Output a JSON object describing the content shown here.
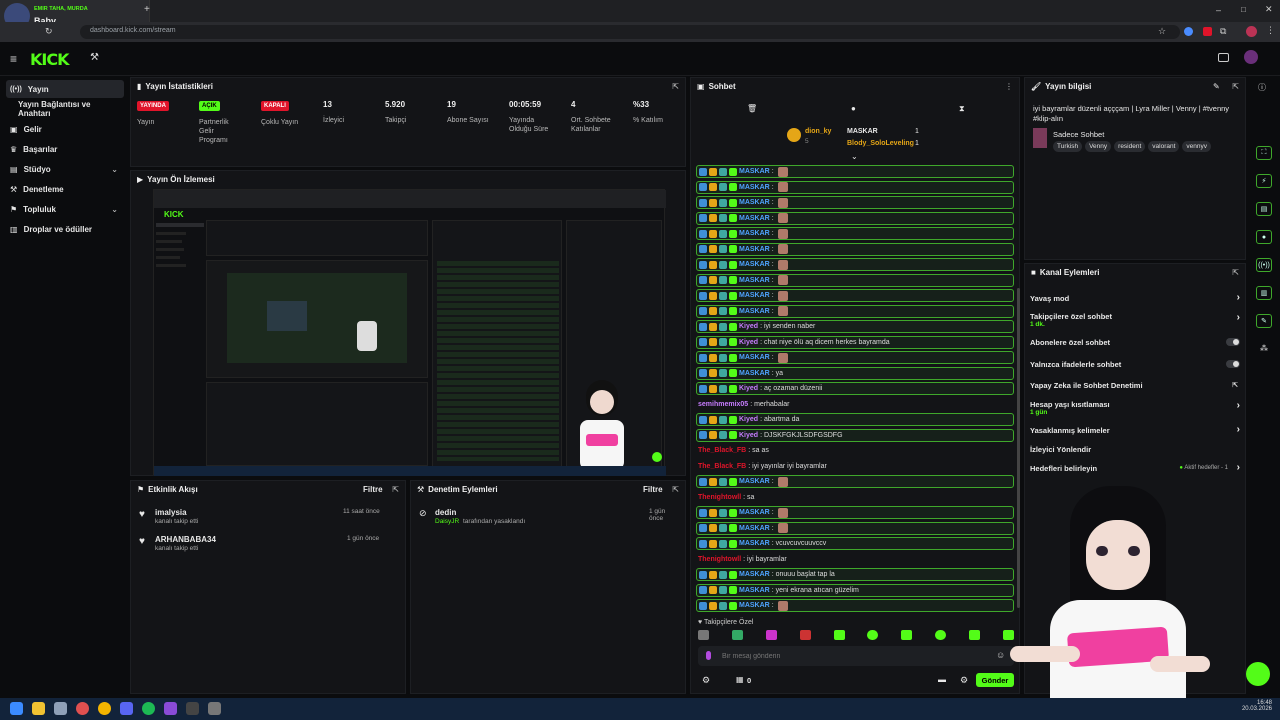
{
  "browser": {
    "tab_channel": "EMIR TAHA, MURDA",
    "tab_title": "Baby",
    "url": "dashboard.kick.com/stream"
  },
  "header": {
    "logo": "KICK"
  },
  "sidebar": {
    "items": [
      {
        "label": "Yayın"
      },
      {
        "label": "Yayın Bağlantısı ve Anahtarı"
      },
      {
        "label": "Gelir"
      },
      {
        "label": "Başarılar"
      },
      {
        "label": "Stüdyo"
      },
      {
        "label": "Denetleme"
      },
      {
        "label": "Topluluk"
      },
      {
        "label": "Droplar ve ödüller"
      }
    ]
  },
  "stats": {
    "title": "Yayın İstatistikleri",
    "items": [
      {
        "badge": "YAYINDA",
        "label": "Yayın",
        "color": "#e0142a"
      },
      {
        "badge": "AÇIK",
        "label": "Partnerlik Gelir Programı",
        "color": "#53fc18"
      },
      {
        "badge": "KAPALI",
        "label": "Çoklu Yayın",
        "color": "#e0142a"
      },
      {
        "value": "13",
        "label": "İzleyici"
      },
      {
        "value": "5.920",
        "label": "Takipçi"
      },
      {
        "value": "19",
        "label": "Abone Sayısı"
      },
      {
        "value": "00:05:59",
        "label": "Yayında Olduğu Süre"
      },
      {
        "value": "4",
        "label": "Ort. Sohbete Katılanlar"
      },
      {
        "value": "%33",
        "label": "% Katılım"
      }
    ]
  },
  "preview": {
    "title": "Yayın Ön İzlemesi"
  },
  "activity": {
    "title": "Etkinlik Akışı",
    "filter": "Filtre",
    "items": [
      {
        "name": "imalysia",
        "sub": "kanalı takip etti",
        "time": "11 saat önce"
      },
      {
        "name": "ARHANBABA34",
        "sub": "kanalı takip etti",
        "time": "1 gün önce"
      }
    ]
  },
  "moderation": {
    "title": "Denetim Eylemleri",
    "filter": "Filtre",
    "items": [
      {
        "name": "dedin",
        "by": "DaisyJR",
        "sub": "tarafından yasaklandı",
        "time": "1 gün önce"
      }
    ]
  },
  "chat": {
    "title": "Sohbet",
    "pinned": [
      {
        "name": "dion_ky",
        "count": "5"
      },
      {
        "name": "MASKAR",
        "count": "1"
      },
      {
        "name": "Blody_SoloLeveling",
        "count": "1"
      }
    ],
    "messages": [
      {
        "user": "MASKAR",
        "text": ":",
        "hl": true,
        "color": "#4fa3ff"
      },
      {
        "user": "MASKAR",
        "text": ":",
        "hl": true,
        "color": "#4fa3ff"
      },
      {
        "user": "MASKAR",
        "text": ":",
        "hl": true,
        "color": "#4fa3ff"
      },
      {
        "user": "MASKAR",
        "text": ":",
        "hl": true,
        "color": "#4fa3ff"
      },
      {
        "user": "MASKAR",
        "text": ":",
        "hl": true,
        "color": "#4fa3ff"
      },
      {
        "user": "MASKAR",
        "text": ":",
        "hl": true,
        "color": "#4fa3ff"
      },
      {
        "user": "MASKAR",
        "text": ":",
        "hl": true,
        "color": "#4fa3ff"
      },
      {
        "user": "MASKAR",
        "text": ":",
        "hl": true,
        "color": "#4fa3ff"
      },
      {
        "user": "MASKAR",
        "text": ":",
        "hl": true,
        "color": "#4fa3ff"
      },
      {
        "user": "MASKAR",
        "text": ":",
        "hl": true,
        "color": "#4fa3ff"
      },
      {
        "user": "Kiyed",
        "text": ": iyi senden naber",
        "hl": true,
        "color": "#c77dff"
      },
      {
        "user": "Kiyed",
        "text": ": chat niye ölü aq dicem herkes bayramda",
        "hl": true,
        "color": "#c77dff"
      },
      {
        "user": "MASKAR",
        "text": ":",
        "hl": true,
        "color": "#4fa3ff"
      },
      {
        "user": "MASKAR",
        "text": ": ya",
        "hl": true,
        "color": "#4fa3ff"
      },
      {
        "user": "Kiyed",
        "text": ": aç ozaman düzenii",
        "hl": true,
        "color": "#c77dff"
      },
      {
        "user": "semihmemix05",
        "text": ": merhabalar",
        "hl": false,
        "color": "#c77dff"
      },
      {
        "user": "Kiyed",
        "text": ": abartma da",
        "hl": true,
        "color": "#c77dff"
      },
      {
        "user": "Kiyed",
        "text": ": DJSKFGKJLSDFGSDFG",
        "hl": true,
        "color": "#c77dff"
      },
      {
        "user": "The_Black_FB",
        "text": ": sa as",
        "hl": false,
        "color": "#e0142a"
      },
      {
        "user": "The_Black_FB",
        "text": ": iyi yayınlar iyi bayramlar",
        "hl": false,
        "color": "#e0142a"
      },
      {
        "user": "MASKAR",
        "text": ":",
        "hl": true,
        "color": "#4fa3ff"
      },
      {
        "user": "Thenightowll",
        "text": ": sa",
        "hl": false,
        "color": "#e0142a"
      },
      {
        "user": "MASKAR",
        "text": ":",
        "hl": true,
        "color": "#4fa3ff"
      },
      {
        "user": "MASKAR",
        "text": ":",
        "hl": true,
        "color": "#4fa3ff"
      },
      {
        "user": "MASKAR",
        "text": ": vcuvcuvcuuvccv",
        "hl": true,
        "color": "#4fa3ff"
      },
      {
        "user": "Thenightowll",
        "text": ": iyi bayramlar",
        "hl": false,
        "color": "#e0142a"
      },
      {
        "user": "MASKAR",
        "text": ": onuuu başlat tap la",
        "hl": true,
        "color": "#4fa3ff"
      },
      {
        "user": "MASKAR",
        "text": ": yeni ekrana atıcan güzelim",
        "hl": true,
        "color": "#4fa3ff"
      },
      {
        "user": "MASKAR",
        "text": ":",
        "hl": true,
        "color": "#4fa3ff"
      }
    ],
    "followers_only": "Takipçilere Özel",
    "input_placeholder": "Bir mesaj gönderin",
    "send": "Gönder",
    "count": "0"
  },
  "stream_info": {
    "title": "Yayın bilgisi",
    "stream_title": "iyi bayramlar düzenli açççam | Lyra Miller | Venny | #tvenny #klip-alın",
    "category": "Sadece Sohbet",
    "tags": [
      "Turkish",
      "Venny",
      "resident",
      "valorant",
      "vennyv"
    ]
  },
  "channel_actions": {
    "title": "Kanal Eylemleri",
    "items": [
      {
        "label": "Yavaş mod",
        "sub": "",
        "kind": "chevron"
      },
      {
        "label": "Takipçilere özel sohbet",
        "sub": "1 dk.",
        "kind": "chevron"
      },
      {
        "label": "Abonelere özel sohbet",
        "sub": "",
        "kind": "toggle"
      },
      {
        "label": "Yalnızca ifadelerle sohbet",
        "sub": "",
        "kind": "toggle"
      },
      {
        "label": "Yapay Zeka ile Sohbet Denetimi",
        "sub": "",
        "kind": "link"
      },
      {
        "label": "Hesap yaşı kısıtlaması",
        "sub": "1 gün",
        "kind": "chevron"
      },
      {
        "label": "Yasaklanmış kelimeler",
        "sub": "",
        "kind": "chevron"
      },
      {
        "label": "İzleyici Yönlendir",
        "sub": "",
        "kind": "none"
      },
      {
        "label": "Hedefleri belirleyin",
        "sub": "",
        "kind": "chevron",
        "extra": "Aktif hedefler - 1"
      }
    ]
  },
  "taskbar": {
    "time": "16:48",
    "date": "20.03.2026"
  },
  "colors": {
    "accent": "#53fc18",
    "live": "#e0142a",
    "panel": "#131417"
  }
}
